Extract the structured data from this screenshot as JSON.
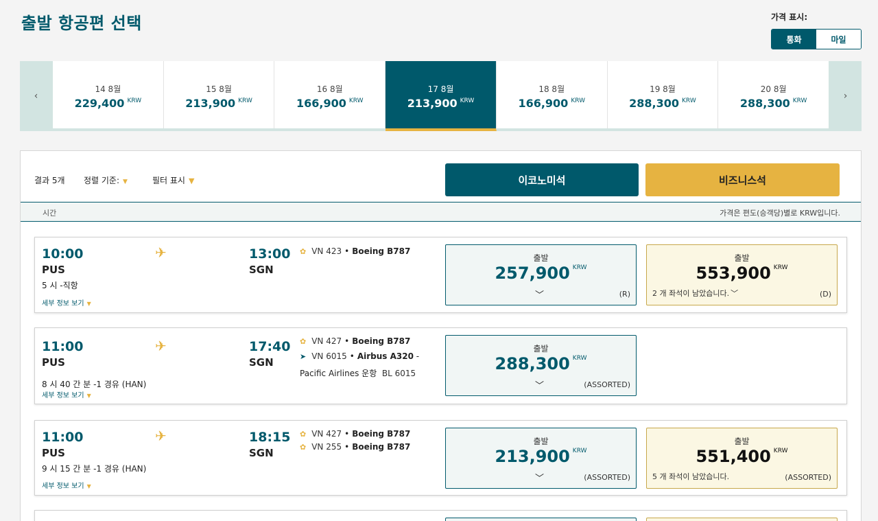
{
  "page": {
    "title": "출발 항공편 선택"
  },
  "price_display": {
    "label": "가격 표시:",
    "options": [
      "통화",
      "마일"
    ],
    "selected": "통화"
  },
  "date_nav": {
    "dates": [
      {
        "date": "14 8월",
        "price": "229,400",
        "currency": "KRW"
      },
      {
        "date": "15 8월",
        "price": "213,900",
        "currency": "KRW"
      },
      {
        "date": "16 8월",
        "price": "166,900",
        "currency": "KRW"
      },
      {
        "date": "17 8월",
        "price": "213,900",
        "currency": "KRW",
        "selected": true
      },
      {
        "date": "18 8월",
        "price": "166,900",
        "currency": "KRW"
      },
      {
        "date": "19 8월",
        "price": "288,300",
        "currency": "KRW"
      },
      {
        "date": "20 8월",
        "price": "288,300",
        "currency": "KRW"
      }
    ],
    "prev_icon": "‹",
    "next_icon": "›"
  },
  "toolbar": {
    "results": "결과 5개",
    "sort_label": "정렬 기준:",
    "filter_label": "필터 표시",
    "economy": "이코노미석",
    "business": "비즈니스석"
  },
  "columns": {
    "time": "시간",
    "price_note": "가격은 편도(승객당)별로 KRW입니다."
  },
  "common": {
    "details": "세부 정보 보기",
    "fare_label": "출발",
    "currency": "KRW"
  },
  "flights": [
    {
      "dep_time": "10:00",
      "dep_ap": "PUS",
      "arr_time": "13:00",
      "arr_ap": "SGN",
      "duration": "5 시 -직항",
      "segments": [
        {
          "code": "VN 423",
          "aircraft": "Boeing B787"
        }
      ],
      "economy": {
        "price": "257,900",
        "class": "(R)"
      },
      "business": {
        "price": "553,900",
        "class": "(D)",
        "seats": "2 개 좌석이 남았습니다."
      }
    },
    {
      "dep_time": "11:00",
      "dep_ap": "PUS",
      "arr_time": "17:40",
      "arr_ap": "SGN",
      "duration": "8 시 40 간 분 -1 경유  (HAN)",
      "segments": [
        {
          "code": "VN 427",
          "aircraft": "Boeing B787"
        },
        {
          "code": "VN 6015",
          "aircraft": "Airbus A320",
          "suffix": " -"
        }
      ],
      "operated_by": "Pacific Airlines 운항",
      "operated_code": "BL  6015",
      "economy": {
        "price": "288,300",
        "class": "(ASSORTED)"
      }
    },
    {
      "dep_time": "11:00",
      "dep_ap": "PUS",
      "arr_time": "18:15",
      "arr_ap": "SGN",
      "duration": "9 시 15 간 분 -1 경유  (HAN)",
      "segments": [
        {
          "code": "VN 427",
          "aircraft": "Boeing B787"
        },
        {
          "code": "VN 255",
          "aircraft": "Boeing B787"
        }
      ],
      "economy": {
        "price": "213,900",
        "class": "(ASSORTED)"
      },
      "business": {
        "price": "551,400",
        "class": "(ASSORTED)",
        "seats": "5 개 좌석이 남았습니다."
      }
    }
  ],
  "colors": {
    "primary": "#00596b",
    "accent": "#e6b341"
  }
}
